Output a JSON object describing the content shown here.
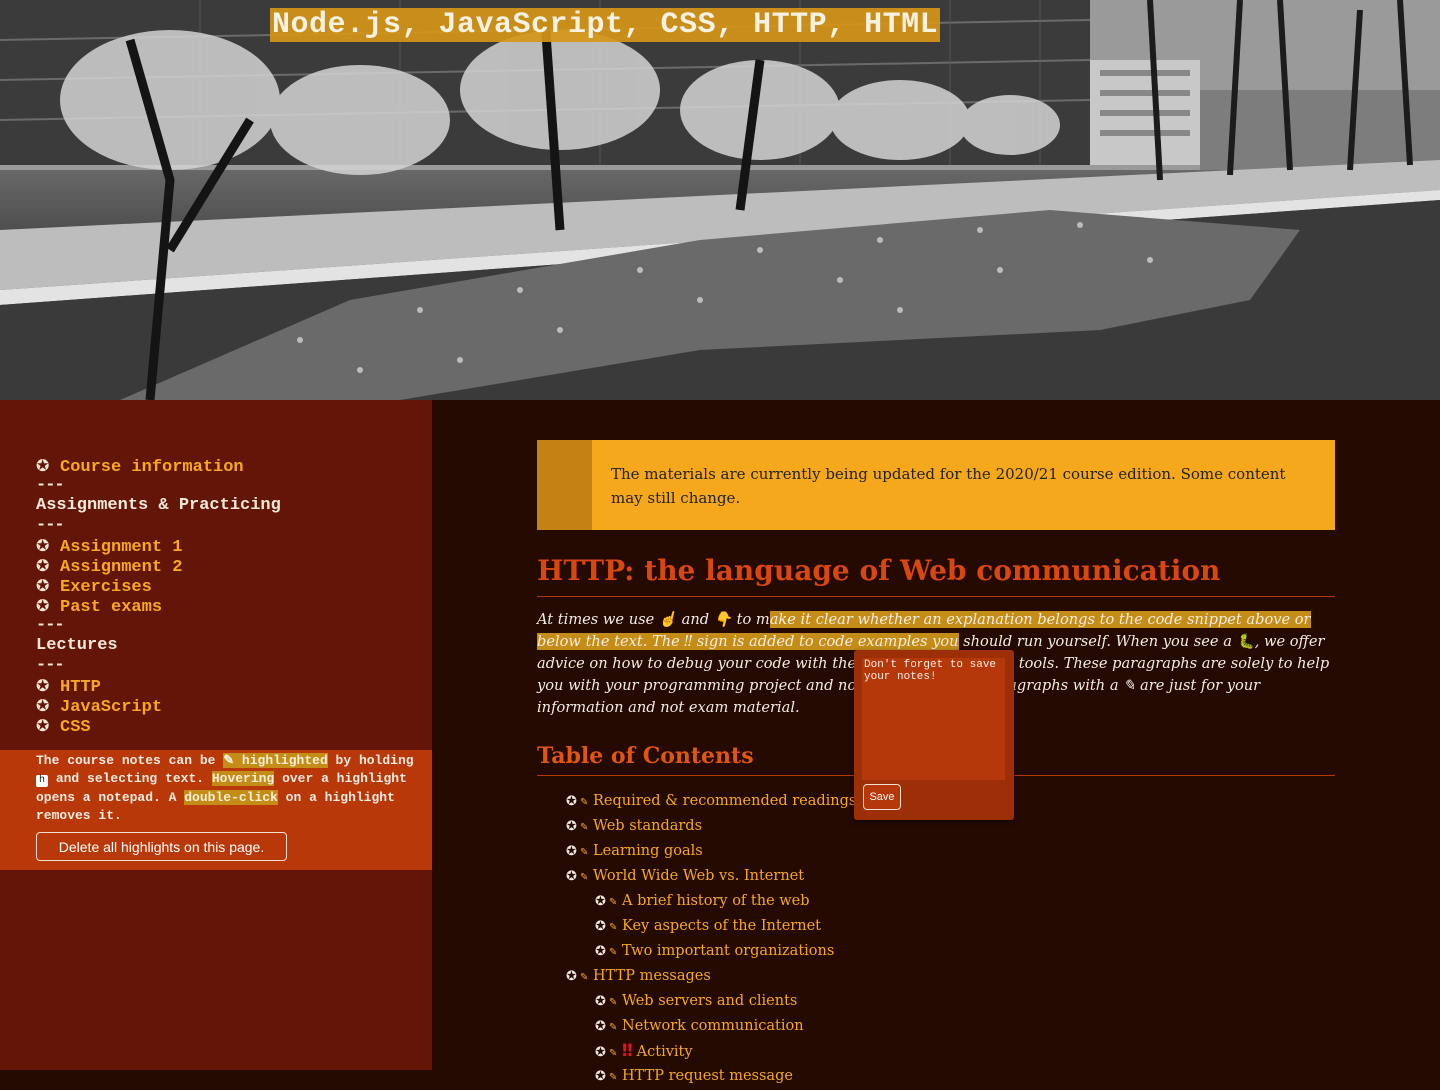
{
  "header": {
    "site_title": "Node.js, JavaScript, CSS, HTTP, HTML"
  },
  "sidebar": {
    "nav": [
      {
        "type": "link",
        "label": "Course information"
      },
      {
        "type": "sep",
        "label": "---"
      },
      {
        "type": "head",
        "label": "Assignments & Practicing"
      },
      {
        "type": "sep",
        "label": "---"
      },
      {
        "type": "link",
        "label": "Assignment 1"
      },
      {
        "type": "link",
        "label": "Assignment 2"
      },
      {
        "type": "link",
        "label": "Exercises"
      },
      {
        "type": "link",
        "label": "Past exams"
      },
      {
        "type": "sep",
        "label": "---"
      },
      {
        "type": "head",
        "label": "Lectures"
      },
      {
        "type": "sep",
        "label": "---"
      },
      {
        "type": "link",
        "label": "HTTP"
      },
      {
        "type": "link",
        "label": "JavaScript"
      },
      {
        "type": "link",
        "label": "CSS"
      }
    ],
    "highlight_help": {
      "t1": "The course notes can be ",
      "m1": "✎ highlighted",
      "t2": " by holding ",
      "key": "h",
      "t3": " and selecting text. ",
      "m2": "Hovering",
      "t4": " over a highlight opens a notepad. A ",
      "m3": "double-click",
      "t5": " on a highlight removes it."
    },
    "delete_button": "Delete all highlights on this page."
  },
  "main": {
    "notice": "The materials are currently being updated for the 2020/21 course edition. Some content may still change.",
    "title": "HTTP: the language of Web communication",
    "intro": {
      "a": "At times we use ",
      "up": "☝",
      "b": " and ",
      "down": "👇",
      "c": " to m",
      "mark": "ake it clear whether an explanation belongs to the code snippet above or below the text. The ‼ sign is added to code examples you",
      "d": " should run yourself. When you see a ",
      "bug": "🐛",
      "e": ", we offer advice on how to debug your code with the browser’s and VSC’s tools. These paragraphs are solely to help you with your programming project and not exam material! Paragraphs with a ",
      "pin": "✎",
      "f": " are just for your information and not exam material."
    },
    "toc_title": "Table of Contents",
    "toc": [
      {
        "level": 1,
        "label": "Required & recommended readings and activities"
      },
      {
        "level": 1,
        "label": "Web standards"
      },
      {
        "level": 1,
        "label": "Learning goals"
      },
      {
        "level": 1,
        "label": "World Wide Web vs. Internet"
      },
      {
        "level": 2,
        "label": "A brief history of the web"
      },
      {
        "level": 2,
        "label": "Key aspects of the Internet"
      },
      {
        "level": 2,
        "label": "Two important organizations"
      },
      {
        "level": 1,
        "label": "HTTP messages"
      },
      {
        "level": 2,
        "label": "Web servers and clients"
      },
      {
        "level": 2,
        "label": "Network communication"
      },
      {
        "level": 2,
        "label": "Activity",
        "prefix": "‼"
      },
      {
        "level": 2,
        "label": "HTTP request message"
      }
    ]
  },
  "notepad": {
    "placeholder": "Don't forget to save your notes!",
    "save_label": "Save"
  },
  "colors": {
    "sidebar_bg": "#631608",
    "main_bg": "#250a02",
    "accent_orange": "#f6a823",
    "heading_red": "#d8470f",
    "notice_yellow": "#f6a81c",
    "highlight": "#c48d18"
  },
  "icons": {
    "nav_bullet": "✪",
    "toc_bullet": "✪",
    "toc_pin": "✎"
  }
}
